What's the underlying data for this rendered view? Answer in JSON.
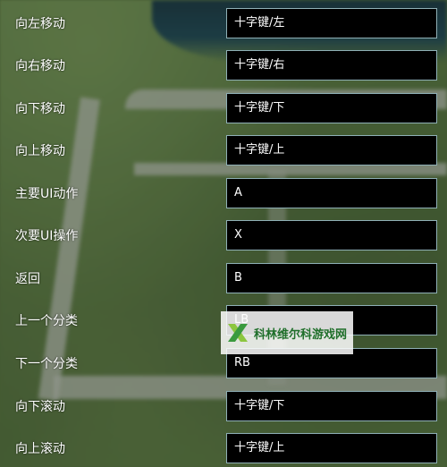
{
  "bindings": [
    {
      "action": "向左移动",
      "key": "十字键/左"
    },
    {
      "action": "向右移动",
      "key": "十字键/右"
    },
    {
      "action": "向下移动",
      "key": "十字键/下"
    },
    {
      "action": "向上移动",
      "key": "十字键/上"
    },
    {
      "action": "主要UI动作",
      "key": "A"
    },
    {
      "action": "次要UI操作",
      "key": "X"
    },
    {
      "action": "返回",
      "key": "B"
    },
    {
      "action": "上一个分类",
      "key": "LB"
    },
    {
      "action": "下一个分类",
      "key": "RB"
    },
    {
      "action": "向下滚动",
      "key": "十字键/下"
    },
    {
      "action": "向上滚动",
      "key": "十字键/上"
    }
  ],
  "watermark": {
    "text": "科林维尔科游戏网",
    "icon": "x-logo-icon"
  },
  "colors": {
    "field_bg": "#000000",
    "field_border": "#8fb0b6",
    "text": "#ffffff",
    "watermark_green": "#1f6f2a"
  }
}
